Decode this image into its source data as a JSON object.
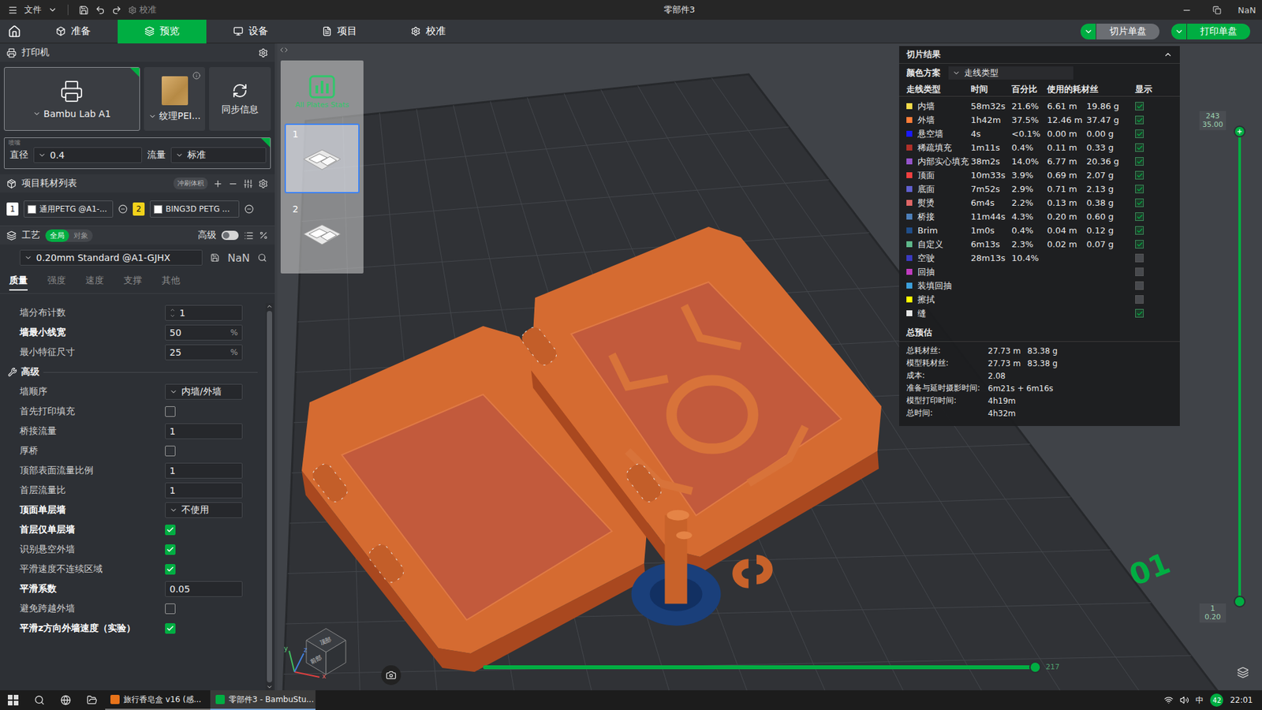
{
  "window": {
    "title": "零部件3",
    "menu": "文件",
    "calibrate": "校准"
  },
  "nav": {
    "tabs": [
      {
        "label": "准备",
        "selected": false
      },
      {
        "label": "预览",
        "selected": true
      },
      {
        "label": "设备",
        "selected": false
      },
      {
        "label": "项目",
        "selected": false
      },
      {
        "label": "校准",
        "selected": false
      }
    ],
    "actions": [
      {
        "label": "切片单盘",
        "primary": false
      },
      {
        "label": "打印单盘",
        "primary": true
      }
    ]
  },
  "printer": {
    "title": "打印机",
    "cards": [
      {
        "label": "Bambu Lab A1",
        "kind": "printer",
        "selected": true
      },
      {
        "label": "纹理PEI...",
        "kind": "plate",
        "selected": false
      },
      {
        "label": "同步信息",
        "kind": "sync",
        "selected": false
      }
    ],
    "nozzle": {
      "caption": "喷嘴",
      "diameter_label": "直径",
      "diameter": "0.4",
      "flow_label": "流量",
      "flow": "标准"
    }
  },
  "filaments": {
    "title": "项目耗材列表",
    "badge": "冲刷体积",
    "items": [
      {
        "index": "1",
        "name": "通用PETG @A1-...",
        "index_color": "#ffffff",
        "swatch": "#ffffff"
      },
      {
        "index": "2",
        "name": "BING3D PETG ...",
        "index_color": "#f2d21b",
        "swatch": "#ffffff"
      }
    ]
  },
  "process": {
    "title": "工艺",
    "scope": [
      {
        "label": "全局",
        "selected": true
      },
      {
        "label": "对象",
        "selected": false
      }
    ],
    "advanced_label": "高级",
    "advanced_on": false,
    "preset": "0.20mm Standard @A1-GJHX",
    "tabs": [
      {
        "label": "质量",
        "selected": true
      },
      {
        "label": "强度",
        "selected": false
      },
      {
        "label": "速度",
        "selected": false
      },
      {
        "label": "支撑",
        "selected": false
      },
      {
        "label": "其他",
        "selected": false
      }
    ],
    "settings": [
      {
        "kind": "spin",
        "label": "墙分布计数",
        "value": "1",
        "modified": false
      },
      {
        "kind": "number",
        "label": "墙最小线宽",
        "value": "50",
        "unit": "%",
        "modified": true
      },
      {
        "kind": "number",
        "label": "最小特征尺寸",
        "value": "25",
        "unit": "%",
        "modified": false
      },
      {
        "kind": "section",
        "label": "高级"
      },
      {
        "kind": "select",
        "label": "墙顺序",
        "value": "内墙/外墙",
        "modified": false
      },
      {
        "kind": "check",
        "label": "首先打印填充",
        "checked": false,
        "modified": false
      },
      {
        "kind": "number",
        "label": "桥接流量",
        "value": "1",
        "modified": false
      },
      {
        "kind": "check",
        "label": "厚桥",
        "checked": false,
        "modified": false
      },
      {
        "kind": "number",
        "label": "顶部表面流量比例",
        "value": "1",
        "modified": false
      },
      {
        "kind": "number",
        "label": "首层流量比",
        "value": "1",
        "modified": false
      },
      {
        "kind": "select",
        "label": "顶面单层墙",
        "value": "不使用",
        "modified": true
      },
      {
        "kind": "check",
        "label": "首层仅单层墙",
        "checked": true,
        "modified": true
      },
      {
        "kind": "check",
        "label": "识别悬空外墙",
        "checked": true,
        "modified": false
      },
      {
        "kind": "check",
        "label": "平滑速度不连续区域",
        "checked": true,
        "modified": false
      },
      {
        "kind": "number",
        "label": "平滑系数",
        "value": "0.05",
        "modified": true
      },
      {
        "kind": "check",
        "label": "避免跨越外墙",
        "checked": false,
        "modified": false
      },
      {
        "kind": "check",
        "label": "平滑z方向外墙速度（实验）",
        "checked": true,
        "modified": true
      }
    ]
  },
  "plates": {
    "stats_label": "All Plates Stats",
    "items": [
      {
        "label": "1",
        "selected": true
      },
      {
        "label": "2",
        "selected": false
      }
    ]
  },
  "results": {
    "title": "切片结果",
    "scheme_label": "颜色方案",
    "scheme": "走线类型",
    "columns": [
      "走线类型",
      "时间",
      "百分比",
      "使用的耗材丝",
      "显示"
    ],
    "rows": [
      {
        "label": "内墙",
        "time": "58m32s",
        "percent": "21.6%",
        "length": "6.61 m",
        "weight": "19.86 g",
        "color": "#f5dc4a",
        "shown": true
      },
      {
        "label": "外墙",
        "time": "1h42m",
        "percent": "37.5%",
        "length": "12.46 m",
        "weight": "37.47 g",
        "color": "#ff7d38",
        "shown": true
      },
      {
        "label": "悬空墙",
        "time": "4s",
        "percent": "<0.1%",
        "length": "0.00 m",
        "weight": "0.00 g",
        "color": "#1a1aff",
        "shown": true
      },
      {
        "label": "稀疏填充",
        "time": "1m11s",
        "percent": "0.4%",
        "length": "0.11 m",
        "weight": "0.33 g",
        "color": "#b03029",
        "shown": true
      },
      {
        "label": "内部实心填充",
        "time": "38m2s",
        "percent": "14.0%",
        "length": "6.77 m",
        "weight": "20.36 g",
        "color": "#9654cc",
        "shown": true
      },
      {
        "label": "顶面",
        "time": "10m33s",
        "percent": "3.9%",
        "length": "0.69 m",
        "weight": "2.07 g",
        "color": "#f04040",
        "shown": true
      },
      {
        "label": "底面",
        "time": "7m52s",
        "percent": "2.9%",
        "length": "0.71 m",
        "weight": "2.13 g",
        "color": "#6060d0",
        "shown": true
      },
      {
        "label": "熨烫",
        "time": "6m4s",
        "percent": "2.2%",
        "length": "0.13 m",
        "weight": "0.38 g",
        "color": "#e06666",
        "shown": true
      },
      {
        "label": "桥接",
        "time": "11m44s",
        "percent": "4.3%",
        "length": "0.20 m",
        "weight": "0.60 g",
        "color": "#4d80ba",
        "shown": true
      },
      {
        "label": "Brim",
        "time": "1m0s",
        "percent": "0.4%",
        "length": "0.04 m",
        "weight": "0.12 g",
        "color": "#1f4e8a",
        "shown": true
      },
      {
        "label": "自定义",
        "time": "6m13s",
        "percent": "2.3%",
        "length": "0.02 m",
        "weight": "0.07 g",
        "color": "#5eb88a",
        "shown": true
      },
      {
        "label": "空驶",
        "time": "28m13s",
        "percent": "10.4%",
        "length": "",
        "weight": "",
        "color": "#3a3ac0",
        "shown": false
      },
      {
        "label": "回抽",
        "time": "",
        "percent": "",
        "length": "",
        "weight": "",
        "color": "#c03cc0",
        "shown": false
      },
      {
        "label": "装填回抽",
        "time": "",
        "percent": "",
        "length": "",
        "weight": "",
        "color": "#3ca0dc",
        "shown": false
      },
      {
        "label": "擦拭",
        "time": "",
        "percent": "",
        "length": "",
        "weight": "",
        "color": "#ffff00",
        "shown": false
      },
      {
        "label": "缝",
        "time": "",
        "percent": "",
        "length": "",
        "weight": "",
        "color": "#e6e6e6",
        "shown": true
      }
    ],
    "totals_title": "总预估",
    "totals": [
      {
        "label": "总耗材丝:",
        "values": [
          "27.73 m",
          "83.38 g"
        ]
      },
      {
        "label": "模型耗材丝:",
        "values": [
          "27.73 m",
          "83.38 g"
        ]
      },
      {
        "label": "成本:",
        "values": [
          "2.08"
        ]
      },
      {
        "label": "准备与延时摄影时间:",
        "values": [
          "6m21s + 6m16s"
        ]
      },
      {
        "label": "模型打印时间:",
        "values": [
          "4h19m"
        ]
      },
      {
        "label": "总时间:",
        "values": [
          "4h32m"
        ]
      }
    ]
  },
  "layer_slider": {
    "top": {
      "layer": "243",
      "height": "35.00"
    },
    "bottom": {
      "layer": "1",
      "height": "0.20"
    },
    "level": 1
  },
  "move_slider": {
    "reading": "217",
    "level": 1
  },
  "bed": {
    "label": "01"
  },
  "gizmo": {
    "top": "顶部",
    "front": "前部",
    "axes": [
      "x",
      "y",
      "z"
    ]
  },
  "taskbar": {
    "apps": [
      {
        "label": "旅行香皂盒 v16 (感...",
        "active": false,
        "color": "#e8731a"
      },
      {
        "label": "零部件3 - BambuStu...",
        "active": true,
        "color": "#00ae42"
      }
    ],
    "ime": "中",
    "badge": "42",
    "clock": "22:01"
  }
}
